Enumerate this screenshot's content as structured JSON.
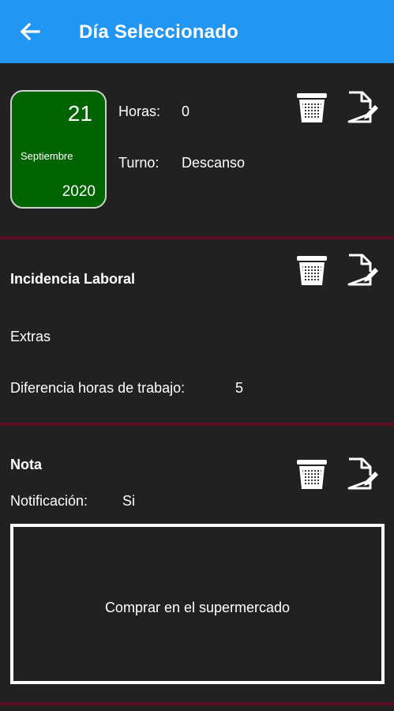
{
  "appbar": {
    "title": "Día Seleccionado",
    "back_icon": "arrow-back-icon",
    "color": "#2196f3"
  },
  "day_card": {
    "day": "21",
    "month": "Septiembre",
    "year": "2020",
    "card_color": "#006400",
    "hours_label": "Horas:",
    "hours_value": "0",
    "shift_label": "Turno:",
    "shift_value": "Descanso"
  },
  "incidence": {
    "title": "Incidencia Laboral",
    "type": "Extras",
    "diff_label": "Diferencia horas de trabajo:",
    "diff_value": "5"
  },
  "note": {
    "title": "Nota",
    "notification_label": "Notificación:",
    "notification_value": "Si",
    "text": "Comprar en el supermercado"
  },
  "icons": {
    "delete": "trash-icon",
    "edit": "edit-document-icon"
  },
  "colors": {
    "background": "#212121",
    "divider": "#5c0d1f"
  }
}
